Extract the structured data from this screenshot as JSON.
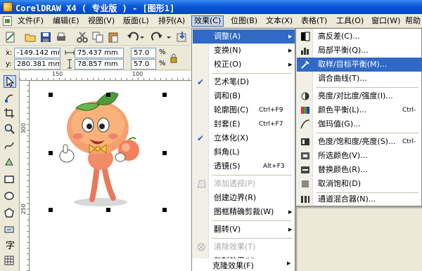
{
  "window": {
    "title": "CorelDRAW X4 ( 专业版 ) - [图形1]"
  },
  "menubar": {
    "items": [
      "文件(F)",
      "编辑(E)",
      "视图(V)",
      "版面(L)",
      "排列(A)",
      "效果(C)",
      "位图(B)",
      "文本(X)",
      "表格(T)",
      "工具(O)",
      "窗口(W)",
      "帮助"
    ]
  },
  "propertybar": {
    "x_label": "x:",
    "x_value": "-149.142 mm",
    "y_label": "y:",
    "y_value": "280.381 mm",
    "width_value": "75.437 mm",
    "height_value": "78.857 mm",
    "scale_w": "57.0",
    "scale_h": "57.0",
    "percent": "%"
  },
  "ruler": {
    "top_marks": [
      "150",
      "100"
    ],
    "left_marks": [
      "300",
      "250"
    ]
  },
  "effects_menu": {
    "items": [
      {
        "label": "调整(A)",
        "arrow": "▶"
      },
      {
        "label": "变换(N)",
        "arrow": "▶"
      },
      {
        "label": "校正(O)",
        "arrow": "▶"
      },
      {
        "label": "艺术笔(D)"
      },
      {
        "label": "调和(B)"
      },
      {
        "label": "轮廓图(C)",
        "shortcut": "Ctrl+F9"
      },
      {
        "label": "封套(E)",
        "shortcut": "Ctrl+F7"
      },
      {
        "label": "立体化(X)"
      },
      {
        "label": "斜角(L)"
      },
      {
        "label": "透镜(S)",
        "shortcut": "Alt+F3"
      },
      {
        "label": "添加透视(P)"
      },
      {
        "label": "创建边界(R)"
      },
      {
        "label": "图框精确剪裁(W)",
        "arrow": "▶"
      },
      {
        "label": "翻转(V)",
        "arrow": "▶"
      },
      {
        "label": "清除效果(T)"
      },
      {
        "label": "复制效果(Y)",
        "arrow": "▶"
      },
      {
        "label": "克隆效果(F)",
        "arrow": "▶"
      }
    ]
  },
  "adjust_submenu": {
    "items": [
      {
        "label": "高反差(C)..."
      },
      {
        "label": "局部平衡(Q)..."
      },
      {
        "label": "取样/目标平衡(M)..."
      },
      {
        "label": "调合曲线(T)..."
      },
      {
        "label": "亮度/对比度/强度(I)..."
      },
      {
        "label": "颜色平衡(L)...",
        "shortcut": "Ctrl-"
      },
      {
        "label": "伽玛值(G)..."
      },
      {
        "label": "色度/饱和度/亮度(S)...",
        "shortcut": "Ctrl-"
      },
      {
        "label": "所选颜色(V)..."
      },
      {
        "label": "替换颜色(R)..."
      },
      {
        "label": "取消饱和(D)"
      },
      {
        "label": "通道混合器(N)..."
      }
    ]
  },
  "colors": {
    "highlight": "#3169c6",
    "titlebar": "#0a55d8",
    "check": "#2a62c9"
  }
}
